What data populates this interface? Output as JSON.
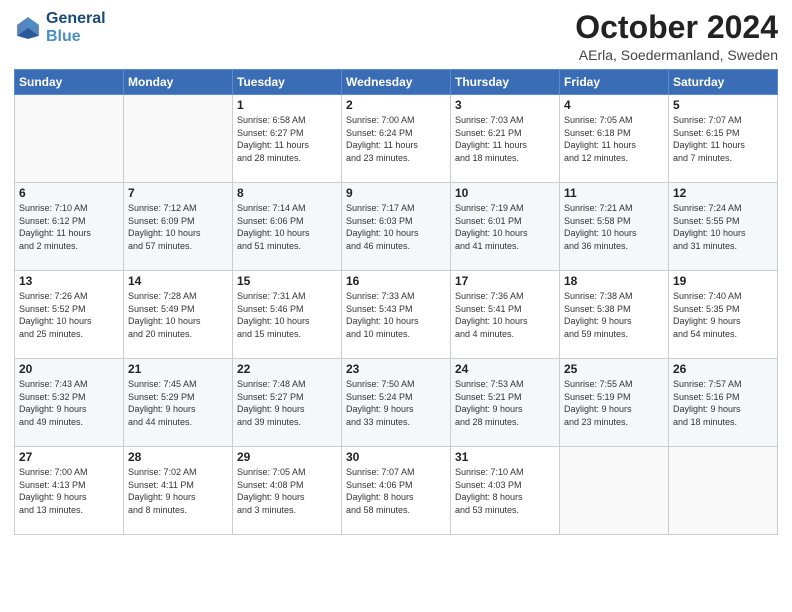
{
  "header": {
    "logo_line1": "General",
    "logo_line2": "Blue",
    "month": "October 2024",
    "location": "AErla, Soedermanland, Sweden"
  },
  "weekdays": [
    "Sunday",
    "Monday",
    "Tuesday",
    "Wednesday",
    "Thursday",
    "Friday",
    "Saturday"
  ],
  "weeks": [
    [
      {
        "day": "",
        "info": ""
      },
      {
        "day": "",
        "info": ""
      },
      {
        "day": "1",
        "info": "Sunrise: 6:58 AM\nSunset: 6:27 PM\nDaylight: 11 hours\nand 28 minutes."
      },
      {
        "day": "2",
        "info": "Sunrise: 7:00 AM\nSunset: 6:24 PM\nDaylight: 11 hours\nand 23 minutes."
      },
      {
        "day": "3",
        "info": "Sunrise: 7:03 AM\nSunset: 6:21 PM\nDaylight: 11 hours\nand 18 minutes."
      },
      {
        "day": "4",
        "info": "Sunrise: 7:05 AM\nSunset: 6:18 PM\nDaylight: 11 hours\nand 12 minutes."
      },
      {
        "day": "5",
        "info": "Sunrise: 7:07 AM\nSunset: 6:15 PM\nDaylight: 11 hours\nand 7 minutes."
      }
    ],
    [
      {
        "day": "6",
        "info": "Sunrise: 7:10 AM\nSunset: 6:12 PM\nDaylight: 11 hours\nand 2 minutes."
      },
      {
        "day": "7",
        "info": "Sunrise: 7:12 AM\nSunset: 6:09 PM\nDaylight: 10 hours\nand 57 minutes."
      },
      {
        "day": "8",
        "info": "Sunrise: 7:14 AM\nSunset: 6:06 PM\nDaylight: 10 hours\nand 51 minutes."
      },
      {
        "day": "9",
        "info": "Sunrise: 7:17 AM\nSunset: 6:03 PM\nDaylight: 10 hours\nand 46 minutes."
      },
      {
        "day": "10",
        "info": "Sunrise: 7:19 AM\nSunset: 6:01 PM\nDaylight: 10 hours\nand 41 minutes."
      },
      {
        "day": "11",
        "info": "Sunrise: 7:21 AM\nSunset: 5:58 PM\nDaylight: 10 hours\nand 36 minutes."
      },
      {
        "day": "12",
        "info": "Sunrise: 7:24 AM\nSunset: 5:55 PM\nDaylight: 10 hours\nand 31 minutes."
      }
    ],
    [
      {
        "day": "13",
        "info": "Sunrise: 7:26 AM\nSunset: 5:52 PM\nDaylight: 10 hours\nand 25 minutes."
      },
      {
        "day": "14",
        "info": "Sunrise: 7:28 AM\nSunset: 5:49 PM\nDaylight: 10 hours\nand 20 minutes."
      },
      {
        "day": "15",
        "info": "Sunrise: 7:31 AM\nSunset: 5:46 PM\nDaylight: 10 hours\nand 15 minutes."
      },
      {
        "day": "16",
        "info": "Sunrise: 7:33 AM\nSunset: 5:43 PM\nDaylight: 10 hours\nand 10 minutes."
      },
      {
        "day": "17",
        "info": "Sunrise: 7:36 AM\nSunset: 5:41 PM\nDaylight: 10 hours\nand 4 minutes."
      },
      {
        "day": "18",
        "info": "Sunrise: 7:38 AM\nSunset: 5:38 PM\nDaylight: 9 hours\nand 59 minutes."
      },
      {
        "day": "19",
        "info": "Sunrise: 7:40 AM\nSunset: 5:35 PM\nDaylight: 9 hours\nand 54 minutes."
      }
    ],
    [
      {
        "day": "20",
        "info": "Sunrise: 7:43 AM\nSunset: 5:32 PM\nDaylight: 9 hours\nand 49 minutes."
      },
      {
        "day": "21",
        "info": "Sunrise: 7:45 AM\nSunset: 5:29 PM\nDaylight: 9 hours\nand 44 minutes."
      },
      {
        "day": "22",
        "info": "Sunrise: 7:48 AM\nSunset: 5:27 PM\nDaylight: 9 hours\nand 39 minutes."
      },
      {
        "day": "23",
        "info": "Sunrise: 7:50 AM\nSunset: 5:24 PM\nDaylight: 9 hours\nand 33 minutes."
      },
      {
        "day": "24",
        "info": "Sunrise: 7:53 AM\nSunset: 5:21 PM\nDaylight: 9 hours\nand 28 minutes."
      },
      {
        "day": "25",
        "info": "Sunrise: 7:55 AM\nSunset: 5:19 PM\nDaylight: 9 hours\nand 23 minutes."
      },
      {
        "day": "26",
        "info": "Sunrise: 7:57 AM\nSunset: 5:16 PM\nDaylight: 9 hours\nand 18 minutes."
      }
    ],
    [
      {
        "day": "27",
        "info": "Sunrise: 7:00 AM\nSunset: 4:13 PM\nDaylight: 9 hours\nand 13 minutes."
      },
      {
        "day": "28",
        "info": "Sunrise: 7:02 AM\nSunset: 4:11 PM\nDaylight: 9 hours\nand 8 minutes."
      },
      {
        "day": "29",
        "info": "Sunrise: 7:05 AM\nSunset: 4:08 PM\nDaylight: 9 hours\nand 3 minutes."
      },
      {
        "day": "30",
        "info": "Sunrise: 7:07 AM\nSunset: 4:06 PM\nDaylight: 8 hours\nand 58 minutes."
      },
      {
        "day": "31",
        "info": "Sunrise: 7:10 AM\nSunset: 4:03 PM\nDaylight: 8 hours\nand 53 minutes."
      },
      {
        "day": "",
        "info": ""
      },
      {
        "day": "",
        "info": ""
      }
    ]
  ]
}
